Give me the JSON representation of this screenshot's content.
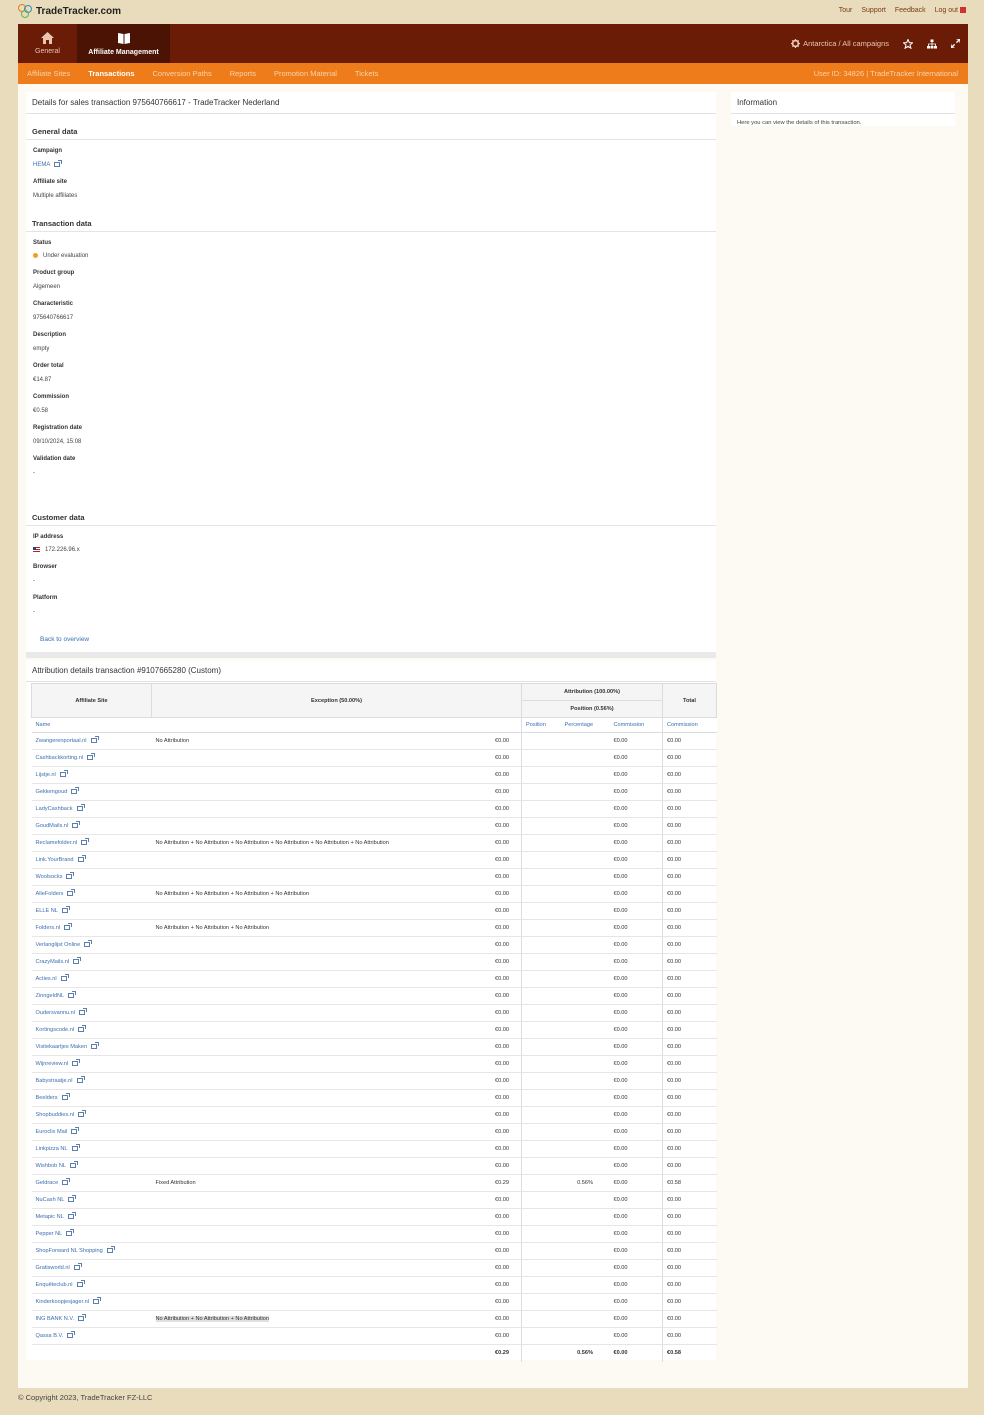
{
  "header": {
    "logo_text": "TradeTracker.com",
    "links": [
      {
        "label": "Tour"
      },
      {
        "label": "Support"
      },
      {
        "label": "Feedback"
      },
      {
        "label": "Log out"
      }
    ]
  },
  "nav": {
    "tabs": [
      {
        "label": "General",
        "icon": "home-icon",
        "active": false
      },
      {
        "label": "Affiliate Management",
        "icon": "book-icon",
        "active": true
      }
    ],
    "campaign_selector": "Antarctica / All campaigns",
    "icons": [
      "gear-icon",
      "star-icon",
      "sitemap-icon",
      "expand-icon"
    ]
  },
  "subnav": {
    "tabs": [
      "Affiliate Sites",
      "Transactions",
      "Conversion Paths",
      "Reports",
      "Promotion Material",
      "Tickets"
    ],
    "active": "Transactions",
    "user_info": "User ID: 34826 | TradeTracker International"
  },
  "details": {
    "title": "Details for sales transaction 975640766617 - TradeTracker Nederland",
    "general": {
      "heading": "General data",
      "campaign_label": "Campaign",
      "campaign_value": "HEMA",
      "site_label": "Affiliate site",
      "site_value": "Multiple affiliates"
    },
    "transaction": {
      "heading": "Transaction data",
      "status_label": "Status",
      "status_value": "Under evaluation",
      "product_group_label": "Product group",
      "product_group_value": "Algemeen",
      "characteristic_label": "Characteristic",
      "characteristic_value": "975640766617",
      "description_label": "Description",
      "description_value": "empty",
      "order_total_label": "Order total",
      "order_total_value": "€14.87",
      "commission_label": "Commission",
      "commission_value": "€0.58",
      "registration_label": "Registration date",
      "registration_value": "09/10/2024, 15:08",
      "validation_label": "Validation date",
      "validation_value": "-"
    },
    "customer": {
      "heading": "Customer data",
      "ip_label": "IP address",
      "ip_value": "172.226.96.x",
      "browser_label": "Browser",
      "browser_value": "-",
      "platform_label": "Platform",
      "platform_value": "-"
    },
    "back_link": "Back to overview"
  },
  "info": {
    "title": "Information",
    "text": "Here you can view the details of this transaction."
  },
  "attribution": {
    "title": "Attribution details transaction #9107665280 (Custom)",
    "headers": {
      "affiliate_site": "Affiliate Site",
      "exception": "Exception (50.00%)",
      "attribution": "Attribution (100.00%)",
      "position_group": "Position (0.56%)",
      "total": "Total"
    },
    "subheaders": {
      "name": "Name",
      "position": "Position",
      "percentage": "Percentage",
      "commission": "Commission",
      "total_commission": "Commission"
    },
    "rows": [
      {
        "name": "Zwangerenportaal.nl",
        "exception": "No Attribution",
        "exc_amount": "€0.00",
        "position": "",
        "percentage": "",
        "commission": "€0.00",
        "total": "€0.00"
      },
      {
        "name": "Cashbackkorting.nl",
        "exception": "",
        "exc_amount": "€0.00",
        "position": "",
        "percentage": "",
        "commission": "€0.00",
        "total": "€0.00"
      },
      {
        "name": "Lijstje.nl",
        "exception": "",
        "exc_amount": "€0.00",
        "position": "",
        "percentage": "",
        "commission": "€0.00",
        "total": "€0.00"
      },
      {
        "name": "Gekkengoud",
        "exception": "",
        "exc_amount": "€0.00",
        "position": "",
        "percentage": "",
        "commission": "€0.00",
        "total": "€0.00"
      },
      {
        "name": "LadyCashback",
        "exception": "",
        "exc_amount": "€0.00",
        "position": "",
        "percentage": "",
        "commission": "€0.00",
        "total": "€0.00"
      },
      {
        "name": "GoudMails.nl",
        "exception": "",
        "exc_amount": "€0.00",
        "position": "",
        "percentage": "",
        "commission": "€0.00",
        "total": "€0.00"
      },
      {
        "name": "Reclamefolder.nl",
        "exception": "No Attribution + No Attribution + No Attribution + No Attribution + No Attribution + No Attribution",
        "exc_amount": "€0.00",
        "position": "",
        "percentage": "",
        "commission": "€0.00",
        "total": "€0.00"
      },
      {
        "name": "Link.YourBrand",
        "exception": "",
        "exc_amount": "€0.00",
        "position": "",
        "percentage": "",
        "commission": "€0.00",
        "total": "€0.00"
      },
      {
        "name": "Woolsocks",
        "exception": "",
        "exc_amount": "€0.00",
        "position": "",
        "percentage": "",
        "commission": "€0.00",
        "total": "€0.00"
      },
      {
        "name": "AlleFolders",
        "exception": "No Attribution + No Attribution + No Attribution + No Attribution",
        "exc_amount": "€0.00",
        "position": "",
        "percentage": "",
        "commission": "€0.00",
        "total": "€0.00"
      },
      {
        "name": "ELLE NL",
        "exception": "",
        "exc_amount": "€0.00",
        "position": "",
        "percentage": "",
        "commission": "€0.00",
        "total": "€0.00"
      },
      {
        "name": "Folders.nl",
        "exception": "No Attribution + No Attribution + No Attribution",
        "exc_amount": "€0.00",
        "position": "",
        "percentage": "",
        "commission": "€0.00",
        "total": "€0.00"
      },
      {
        "name": "Verlanglijst Online",
        "exception": "",
        "exc_amount": "€0.00",
        "position": "",
        "percentage": "",
        "commission": "€0.00",
        "total": "€0.00"
      },
      {
        "name": "CrazyMails.nl",
        "exception": "",
        "exc_amount": "€0.00",
        "position": "",
        "percentage": "",
        "commission": "€0.00",
        "total": "€0.00"
      },
      {
        "name": "Acties.nl",
        "exception": "",
        "exc_amount": "€0.00",
        "position": "",
        "percentage": "",
        "commission": "€0.00",
        "total": "€0.00"
      },
      {
        "name": "ZinngeldNL",
        "exception": "",
        "exc_amount": "€0.00",
        "position": "",
        "percentage": "",
        "commission": "€0.00",
        "total": "€0.00"
      },
      {
        "name": "Oudersvannu.nl",
        "exception": "",
        "exc_amount": "€0.00",
        "position": "",
        "percentage": "",
        "commission": "€0.00",
        "total": "€0.00"
      },
      {
        "name": "Kortingscode.nl",
        "exception": "",
        "exc_amount": "€0.00",
        "position": "",
        "percentage": "",
        "commission": "€0.00",
        "total": "€0.00"
      },
      {
        "name": "Visitekaartjes Maken",
        "exception": "",
        "exc_amount": "€0.00",
        "position": "",
        "percentage": "",
        "commission": "€0.00",
        "total": "€0.00"
      },
      {
        "name": "Wijnreview.nl",
        "exception": "",
        "exc_amount": "€0.00",
        "position": "",
        "percentage": "",
        "commission": "€0.00",
        "total": "€0.00"
      },
      {
        "name": "Babystraatje.nl",
        "exception": "",
        "exc_amount": "€0.00",
        "position": "",
        "percentage": "",
        "commission": "€0.00",
        "total": "€0.00"
      },
      {
        "name": "Beelders",
        "exception": "",
        "exc_amount": "€0.00",
        "position": "",
        "percentage": "",
        "commission": "€0.00",
        "total": "€0.00"
      },
      {
        "name": "Shopbuddies.nl",
        "exception": "",
        "exc_amount": "€0.00",
        "position": "",
        "percentage": "",
        "commission": "€0.00",
        "total": "€0.00"
      },
      {
        "name": "Euroclix Mail",
        "exception": "",
        "exc_amount": "€0.00",
        "position": "",
        "percentage": "",
        "commission": "€0.00",
        "total": "€0.00"
      },
      {
        "name": "Linkpizza NL",
        "exception": "",
        "exc_amount": "€0.00",
        "position": "",
        "percentage": "",
        "commission": "€0.00",
        "total": "€0.00"
      },
      {
        "name": "Wishbob NL",
        "exception": "",
        "exc_amount": "€0.00",
        "position": "",
        "percentage": "",
        "commission": "€0.00",
        "total": "€0.00"
      },
      {
        "name": "Geldrace",
        "exception": "Fixed Attribution",
        "exc_amount": "€0.29",
        "position": "",
        "percentage": "0.56%",
        "commission": "€0.00",
        "total": "€0.58"
      },
      {
        "name": "NuCash NL",
        "exception": "",
        "exc_amount": "€0.00",
        "position": "",
        "percentage": "",
        "commission": "€0.00",
        "total": "€0.00"
      },
      {
        "name": "Metapic NL",
        "exception": "",
        "exc_amount": "€0.00",
        "position": "",
        "percentage": "",
        "commission": "€0.00",
        "total": "€0.00"
      },
      {
        "name": "Pepper NL",
        "exception": "",
        "exc_amount": "€0.00",
        "position": "",
        "percentage": "",
        "commission": "€0.00",
        "total": "€0.00"
      },
      {
        "name": "ShopForward NL Shopping",
        "exception": "",
        "exc_amount": "€0.00",
        "position": "",
        "percentage": "",
        "commission": "€0.00",
        "total": "€0.00"
      },
      {
        "name": "Gratisworld.nl",
        "exception": "",
        "exc_amount": "€0.00",
        "position": "",
        "percentage": "",
        "commission": "€0.00",
        "total": "€0.00"
      },
      {
        "name": "Enquêteclub.nl",
        "exception": "",
        "exc_amount": "€0.00",
        "position": "",
        "percentage": "",
        "commission": "€0.00",
        "total": "€0.00"
      },
      {
        "name": "Kinderkoopjesjager.nl",
        "exception": "",
        "exc_amount": "€0.00",
        "position": "",
        "percentage": "",
        "commission": "€0.00",
        "total": "€0.00"
      },
      {
        "name": "ING BANK N.V.",
        "exception": "No Attribution + No Attribution + No Attribution",
        "exc_amount": "€0.00",
        "position": "",
        "percentage": "",
        "commission": "€0.00",
        "total": "€0.00",
        "highlight": true
      },
      {
        "name": "Qassa B.V.",
        "exception": "",
        "exc_amount": "€0.00",
        "position": "",
        "percentage": "",
        "commission": "€0.00",
        "total": "€0.00"
      }
    ],
    "totals": {
      "exc_amount": "€0.29",
      "percentage": "0.56%",
      "commission": "€0.00",
      "total": "€0.58"
    }
  },
  "footer": {
    "copyright": "© Copyright 2023, TradeTracker FZ-LLC"
  }
}
